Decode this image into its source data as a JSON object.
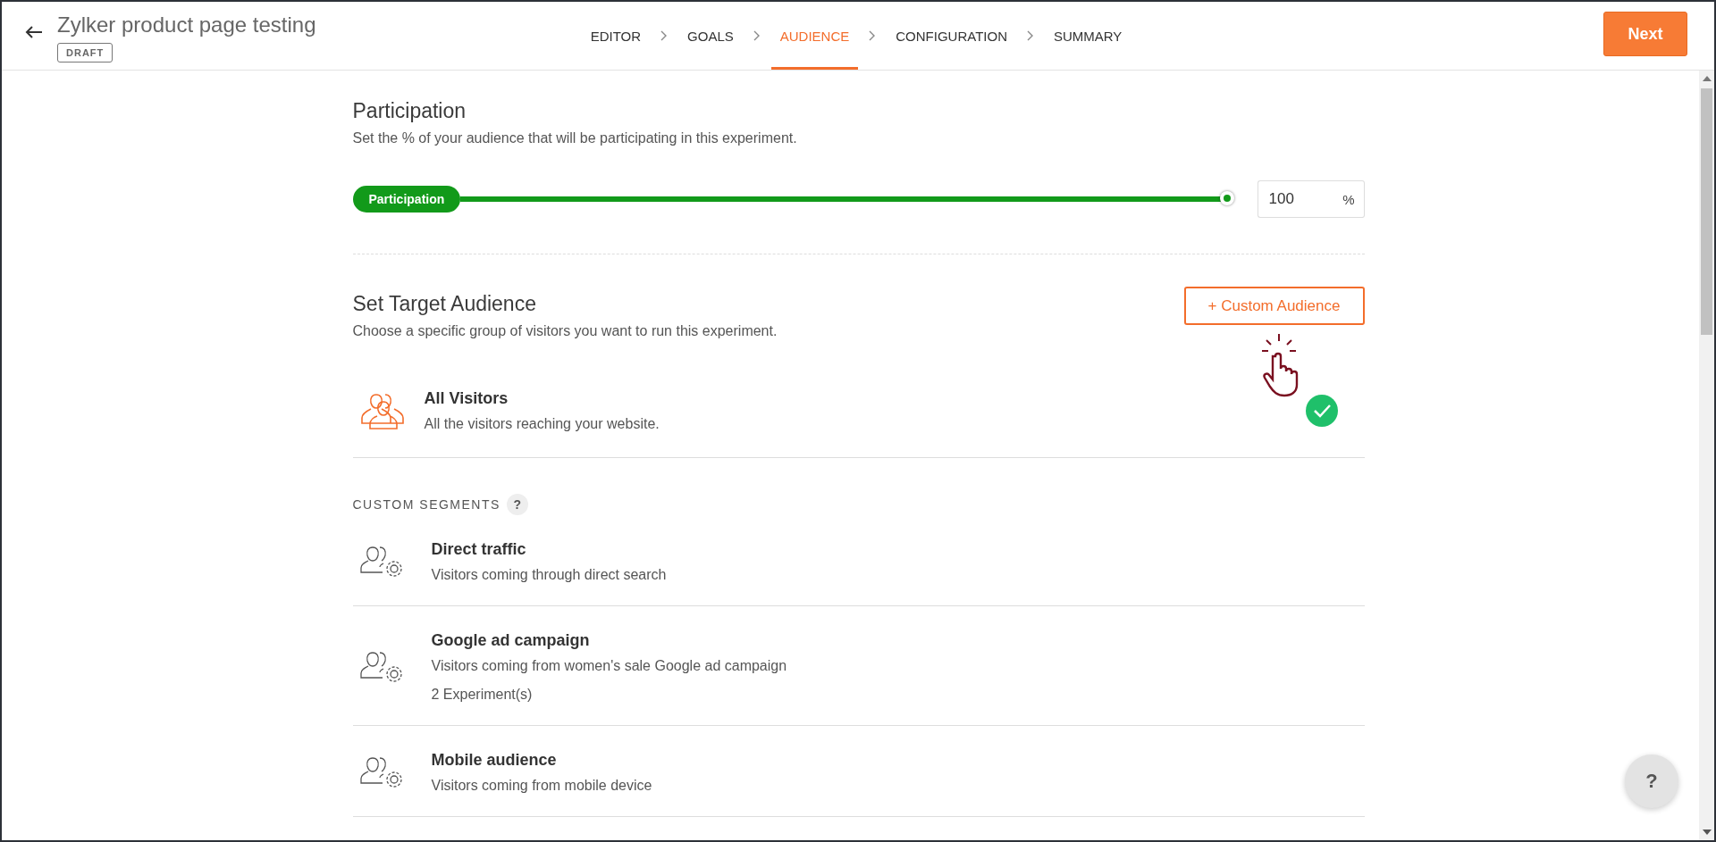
{
  "header": {
    "title": "Zylker product page testing",
    "status": "DRAFT",
    "next_button": "Next"
  },
  "steps": [
    {
      "label": "EDITOR",
      "selected": false
    },
    {
      "label": "GOALS",
      "selected": false
    },
    {
      "label": "AUDIENCE",
      "selected": true
    },
    {
      "label": "CONFIGURATION",
      "selected": false
    },
    {
      "label": "SUMMARY",
      "selected": false
    }
  ],
  "participation": {
    "title": "Participation",
    "description": "Set the % of your audience that will be participating in this experiment.",
    "slider": {
      "label": "Participation",
      "level": 1
    },
    "value": "100",
    "unit": "%"
  },
  "target_audience": {
    "title": "Set Target Audience",
    "description": "Choose a specific group of visitors you want to run this experiment.",
    "button": "+ Custom Audience"
  },
  "audiences": [
    {
      "name": "All Visitors",
      "description": "All the visitors reaching your website.",
      "selected": true
    }
  ],
  "custom_segments": {
    "heading": "CUSTOM SEGMENTS",
    "help": "?",
    "items": [
      {
        "name": "Direct traffic",
        "description": "Visitors coming through direct search"
      },
      {
        "name": "Google ad campaign",
        "description": "Visitors coming from women's sale Google ad campaign",
        "experiments": "2 Experiment(s)"
      },
      {
        "name": "Mobile audience",
        "description": "Visitors coming from mobile device"
      }
    ]
  },
  "help_button": "?"
}
